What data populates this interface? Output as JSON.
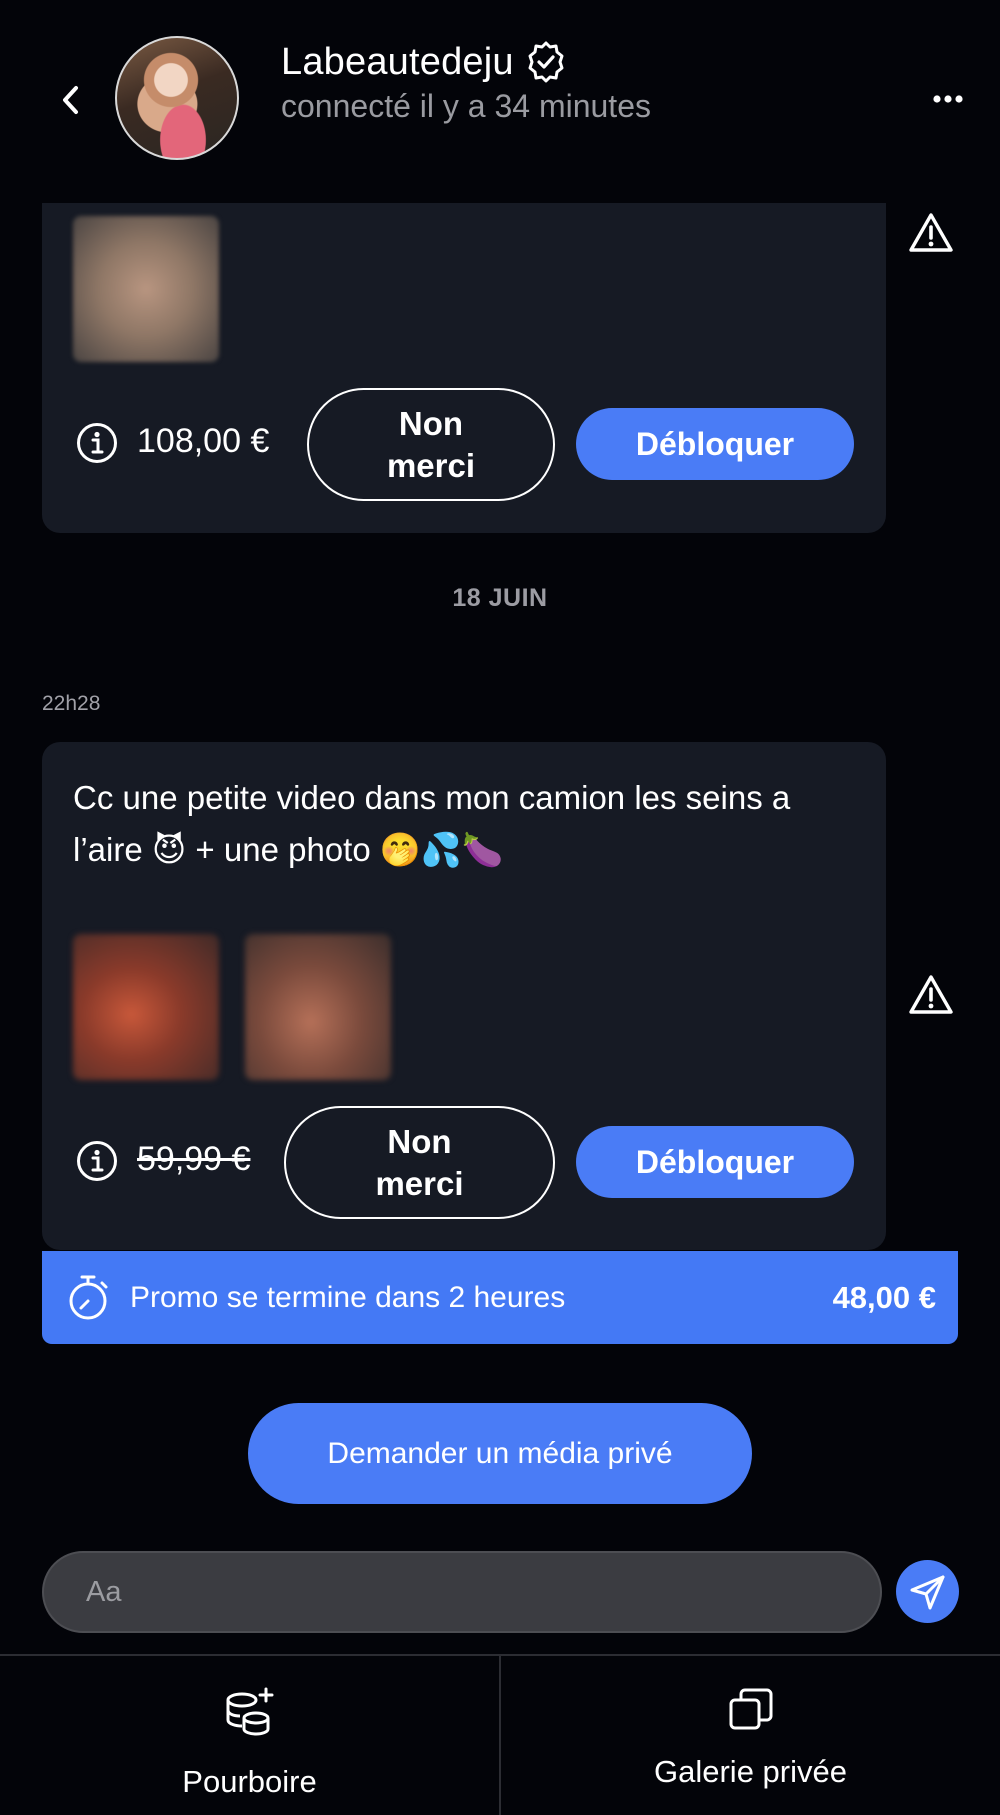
{
  "header": {
    "name": "Labeautedeju",
    "status": "connecté il y a 34 minutes"
  },
  "message1": {
    "price": "108,00 €",
    "decline_label": "Non merci",
    "unlock_label": "Débloquer"
  },
  "date_separator": "18 JUIN",
  "message2": {
    "time": "22h28",
    "text": "Cc une petite video dans mon camion les seins a l’aire 😈 + une photo 🤭💦🍆",
    "original_price": "59,99 €",
    "decline_label": "Non merci",
    "unlock_label": "Débloquer"
  },
  "promo": {
    "text": "Promo se termine dans 2 heures",
    "price": "48,00 €"
  },
  "request_button": "Demander un média privé",
  "composer": {
    "placeholder": "Aa"
  },
  "bottom_nav": {
    "tip_label": "Pourboire",
    "gallery_label": "Galerie privée"
  },
  "colors": {
    "background": "#030409",
    "card": "#161a24",
    "accent": "#4a7cf6",
    "muted_text": "#9a9ba1"
  }
}
